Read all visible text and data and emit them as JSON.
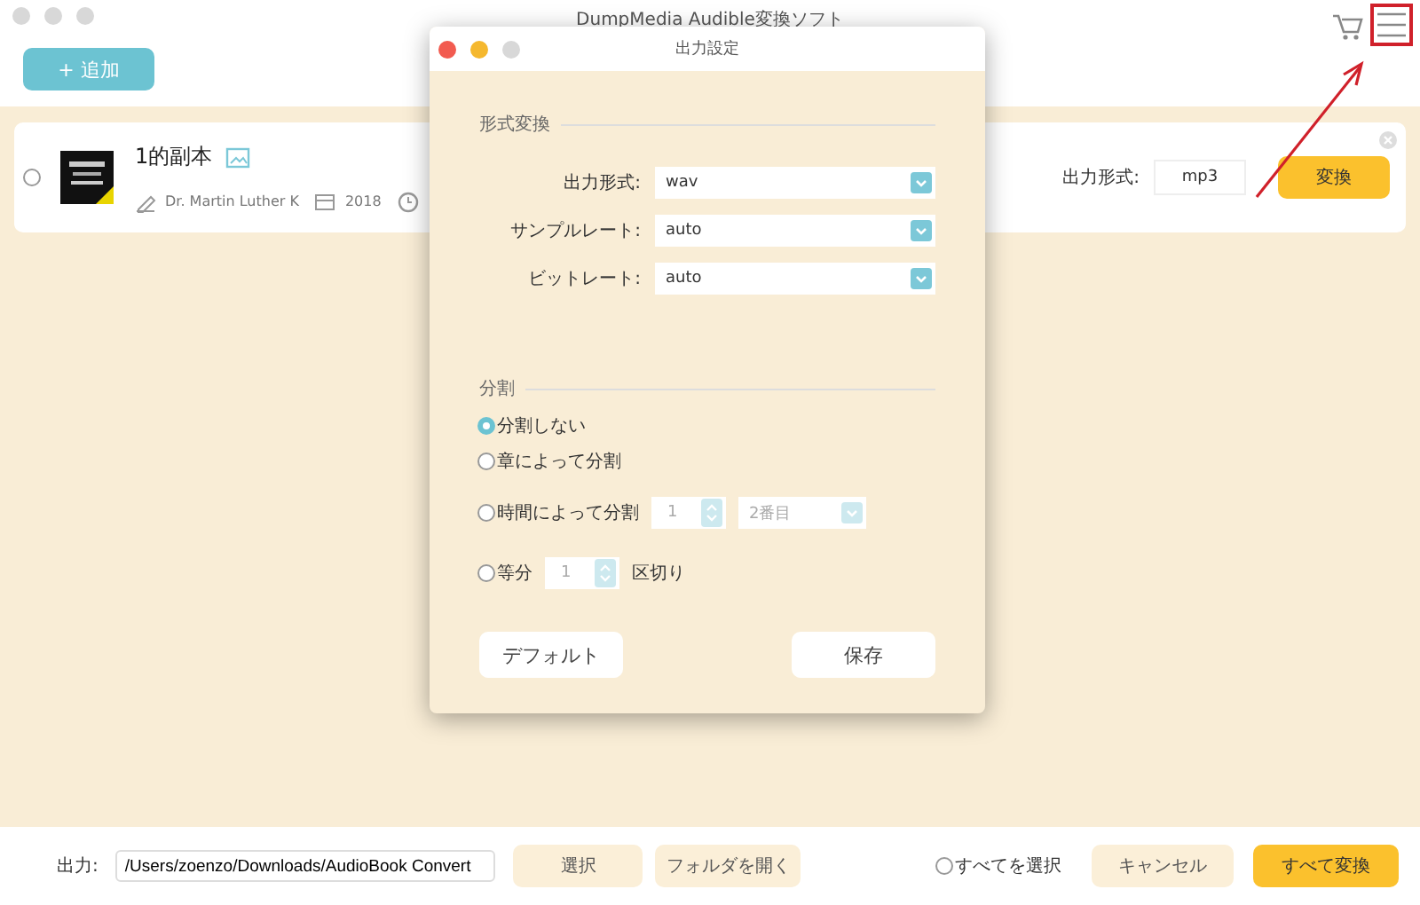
{
  "window": {
    "title": "DumpMedia Audible変換ソフト"
  },
  "toolbar": {
    "add_button": "+ 追加"
  },
  "items": [
    {
      "title": "1的副本",
      "author": "Dr. Martin Luther K",
      "year": "2018",
      "selected": false,
      "format_label": "出力形式:",
      "format": "mp3",
      "convert_button": "変換"
    }
  ],
  "dialog": {
    "title": "出力設定",
    "format_section": {
      "heading": "形式変換",
      "fields": [
        {
          "label": "出力形式:",
          "value": "wav"
        },
        {
          "label": "サンプルレート:",
          "value": "auto"
        },
        {
          "label": "ビットレート:",
          "value": "auto"
        }
      ]
    },
    "split_section": {
      "heading": "分割",
      "options": [
        {
          "kind": "plain",
          "label": "分割しない",
          "selected": true
        },
        {
          "kind": "plain",
          "label": "章によって分割",
          "selected": false
        },
        {
          "kind": "time",
          "label": "時間によって分割",
          "selected": false,
          "number": "1",
          "unit": "2番目"
        },
        {
          "kind": "equal",
          "label": "等分",
          "selected": false,
          "number": "1",
          "suffix": "区切り"
        }
      ]
    },
    "buttons": [
      "デフォルト",
      "保存"
    ]
  },
  "footer": {
    "output_label": "出力:",
    "output_path": "/Users/zoenzo/Downloads/AudioBook Convert",
    "select_button": "選択",
    "open_folder_button": "フォルダを開く",
    "select_all": {
      "label": "すべてを選択",
      "selected": false
    },
    "cancel_button": "キャンセル",
    "convert_all_button": "すべて変換"
  }
}
